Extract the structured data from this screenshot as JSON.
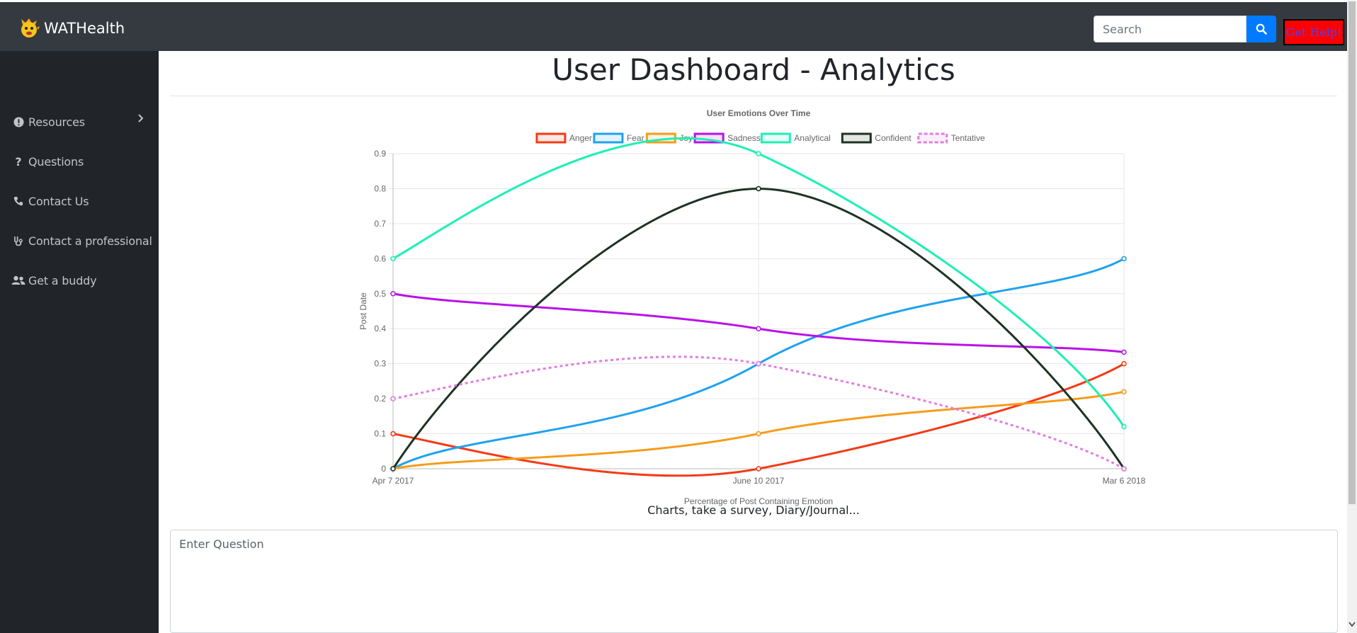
{
  "app": {
    "brand": "WATHealth"
  },
  "header": {
    "search_placeholder": "Search",
    "help_label": "Get Help!"
  },
  "sidebar": {
    "items": [
      {
        "label": "Resources",
        "icon": "exclamation-circle-icon",
        "has_chevron": true
      },
      {
        "label": "Questions",
        "icon": "question-icon"
      },
      {
        "label": "Contact Us",
        "icon": "phone-icon"
      },
      {
        "label": "Contact a professional",
        "icon": "stethoscope-icon"
      },
      {
        "label": "Get a buddy",
        "icon": "users-icon"
      }
    ]
  },
  "main": {
    "title": "User Dashboard - Analytics",
    "caption": "Charts, take a survey, Diary/Journal...",
    "question_placeholder": "Enter Question"
  },
  "chart_data": {
    "type": "line",
    "title": "User Emotions Over Time",
    "xlabel": "Percentage of Post Containing Emotion",
    "ylabel": "Post Date",
    "categories": [
      "Apr 7 2017",
      "June 10 2017",
      "Mar 6 2018"
    ],
    "ylim": [
      0,
      0.9
    ],
    "yticks": [
      "0",
      "0.1",
      "0.2",
      "0.3",
      "0.4",
      "0.5",
      "0.6",
      "0.7",
      "0.8",
      "0.9"
    ],
    "grid": true,
    "legend_position": "top",
    "series": [
      {
        "name": "Anger",
        "values": [
          0.1,
          0,
          0.3
        ],
        "color": "#f33b16",
        "dashed": false
      },
      {
        "name": "Fear",
        "values": [
          0,
          0.3,
          0.6
        ],
        "color": "#1fa2ef",
        "dashed": false
      },
      {
        "name": "Joy",
        "values": [
          0,
          0.1,
          0.22
        ],
        "color": "#f59c1a",
        "dashed": false
      },
      {
        "name": "Sadness",
        "values": [
          0.5,
          0.4,
          0.333
        ],
        "color": "#b912e8",
        "dashed": false
      },
      {
        "name": "Analytical",
        "values": [
          0.6,
          0.9,
          0.12
        ],
        "color": "#1ef0b4",
        "dashed": false
      },
      {
        "name": "Confident",
        "values": [
          0,
          0.8,
          0
        ],
        "color": "#1e3323",
        "dashed": false
      },
      {
        "name": "Tentative",
        "values": [
          0.2,
          0.3,
          0
        ],
        "color": "#e07ee0",
        "dashed": true
      }
    ]
  }
}
